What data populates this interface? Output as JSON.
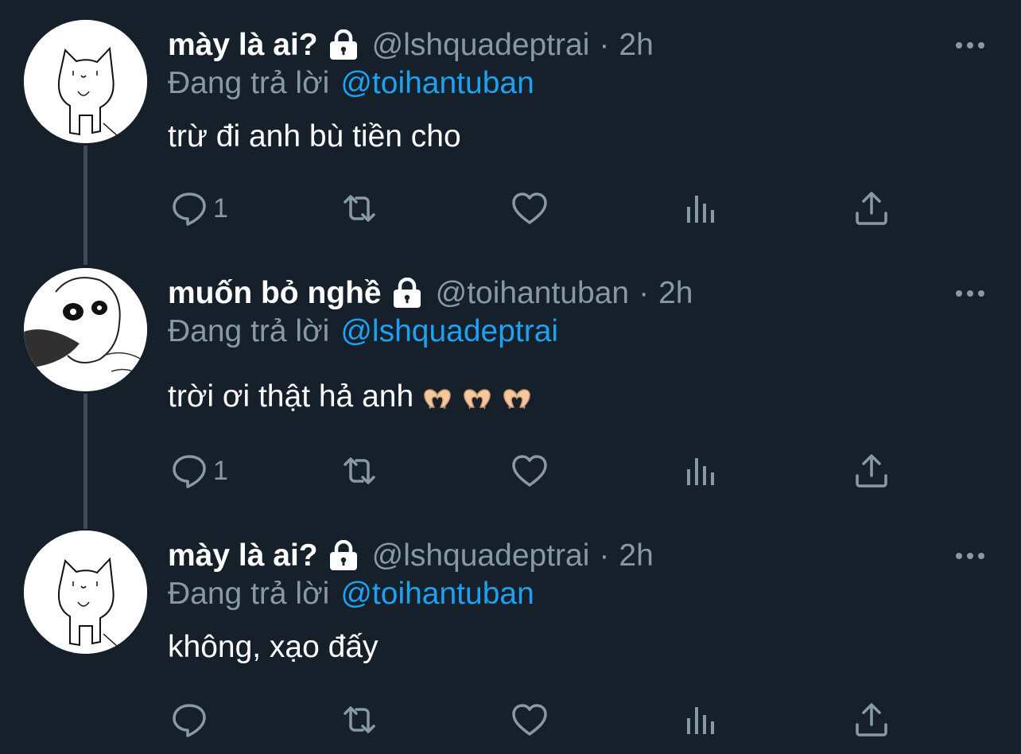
{
  "tweets": [
    {
      "display_name": "mày là ai?",
      "handle": "@lshquadeptrai",
      "separator": "·",
      "time": "2h",
      "reply_prefix": "Đang trả lời",
      "reply_to": "@toihantuban",
      "text": "trừ đi anh bù tiền cho",
      "reply_count": "1",
      "avatar": "cat-drawing"
    },
    {
      "display_name": "muốn bỏ nghề",
      "handle": "@toihantuban",
      "separator": "·",
      "time": "2h",
      "reply_prefix": "Đang trả lời",
      "reply_to": "@lshquadeptrai",
      "text": "trời ơi thật hả anh",
      "emojis": [
        "heart-hands",
        "heart-hands",
        "heart-hands"
      ],
      "reply_count": "1",
      "avatar": "sketch-face"
    },
    {
      "display_name": "mày là ai?",
      "handle": "@lshquadeptrai",
      "separator": "·",
      "time": "2h",
      "reply_prefix": "Đang trả lời",
      "reply_to": "@toihantuban",
      "text": "không, xạo đấy",
      "reply_count": "",
      "avatar": "cat-drawing"
    }
  ],
  "icons": [
    "lock-icon",
    "more-icon",
    "reply-icon",
    "retweet-icon",
    "like-icon",
    "analytics-icon",
    "share-icon",
    "heart-hands-emoji"
  ],
  "colors": {
    "background": "#15202b",
    "text_primary": "#ffffff",
    "text_secondary": "#8899a6",
    "mention": "#1da1f2",
    "thread_line": "#3d4a57"
  }
}
